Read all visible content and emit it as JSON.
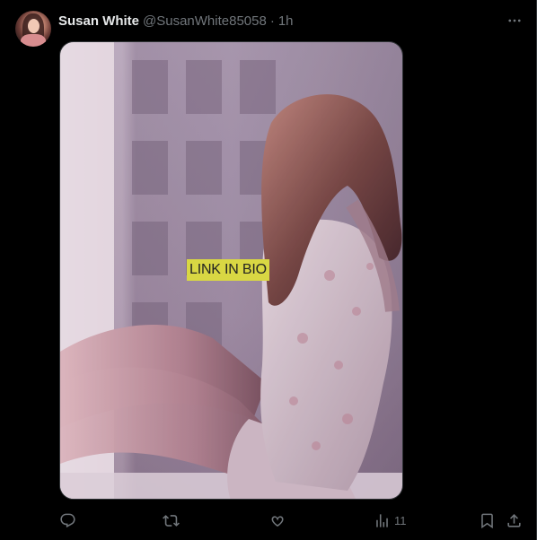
{
  "post": {
    "author_name": "Susan White",
    "author_handle": "@SusanWhite85058",
    "separator": "·",
    "time_ago": "1h",
    "image_overlay_text": "LINK IN BIO"
  },
  "actions": {
    "reply": {
      "icon": "reply-icon"
    },
    "repost": {
      "icon": "repost-icon"
    },
    "like": {
      "icon": "heart-icon"
    },
    "views": {
      "icon": "views-chart-icon",
      "count": "11"
    },
    "bookmark": {
      "icon": "bookmark-icon"
    },
    "share": {
      "icon": "share-icon"
    }
  },
  "colors": {
    "background": "#000000",
    "text_primary": "#e7e9ea",
    "text_secondary": "#71767b",
    "overlay_label_bg": "#d9d743"
  }
}
